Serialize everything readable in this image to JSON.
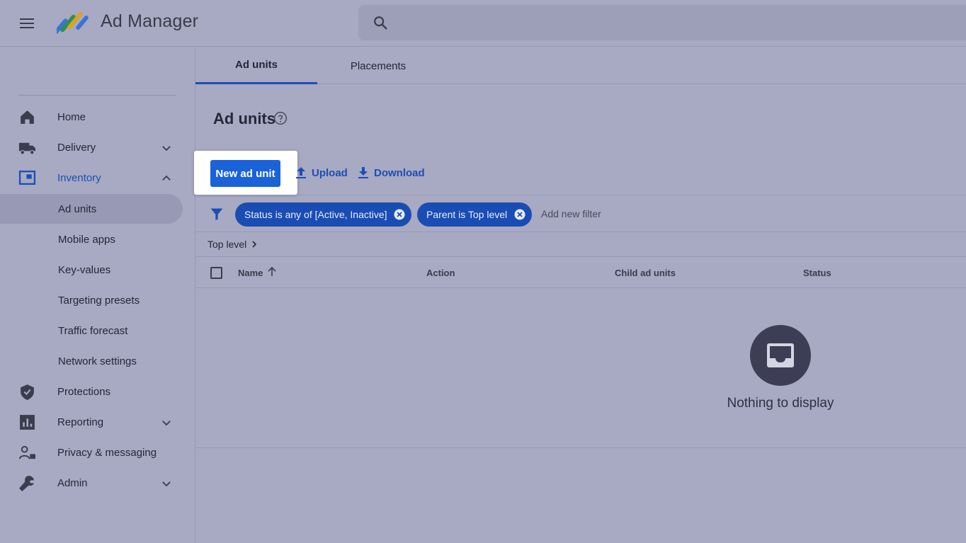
{
  "header": {
    "app_title": "Ad Manager",
    "search_placeholder": ""
  },
  "sidebar": {
    "items": [
      {
        "label": "Home",
        "icon": "home-icon"
      },
      {
        "label": "Delivery",
        "icon": "truck-icon",
        "expandable": true
      },
      {
        "label": "Inventory",
        "icon": "inventory-icon",
        "expanded": true,
        "active": true
      },
      {
        "label": "Protections",
        "icon": "shield-icon"
      },
      {
        "label": "Reporting",
        "icon": "bar-chart-icon",
        "expandable": true
      },
      {
        "label": "Privacy & messaging",
        "icon": "person-lock-icon"
      },
      {
        "label": "Admin",
        "icon": "wrench-icon",
        "expandable": true
      }
    ],
    "inventory_sub_items": [
      {
        "label": "Ad units",
        "selected": true
      },
      {
        "label": "Mobile apps"
      },
      {
        "label": "Key-values"
      },
      {
        "label": "Targeting presets"
      },
      {
        "label": "Traffic forecast"
      },
      {
        "label": "Network settings"
      }
    ]
  },
  "main": {
    "tabs": [
      {
        "label": "Ad units",
        "active": true
      },
      {
        "label": "Placements"
      }
    ],
    "page_title": "Ad units",
    "toolbar": {
      "new_label": "New ad unit",
      "upload_label": "Upload",
      "download_label": "Download"
    },
    "filters": {
      "chips": [
        "Status is any of [Active, Inactive]",
        "Parent is Top level"
      ],
      "add_label": "Add new filter"
    },
    "breadcrumb": "Top level",
    "table": {
      "columns": [
        "Name",
        "Action",
        "Child ad units",
        "Status"
      ]
    },
    "empty_message": "Nothing to display"
  },
  "colors": {
    "accent": "#1a62d8",
    "chip": "#1a4db4",
    "background": "#a8a9c2"
  }
}
